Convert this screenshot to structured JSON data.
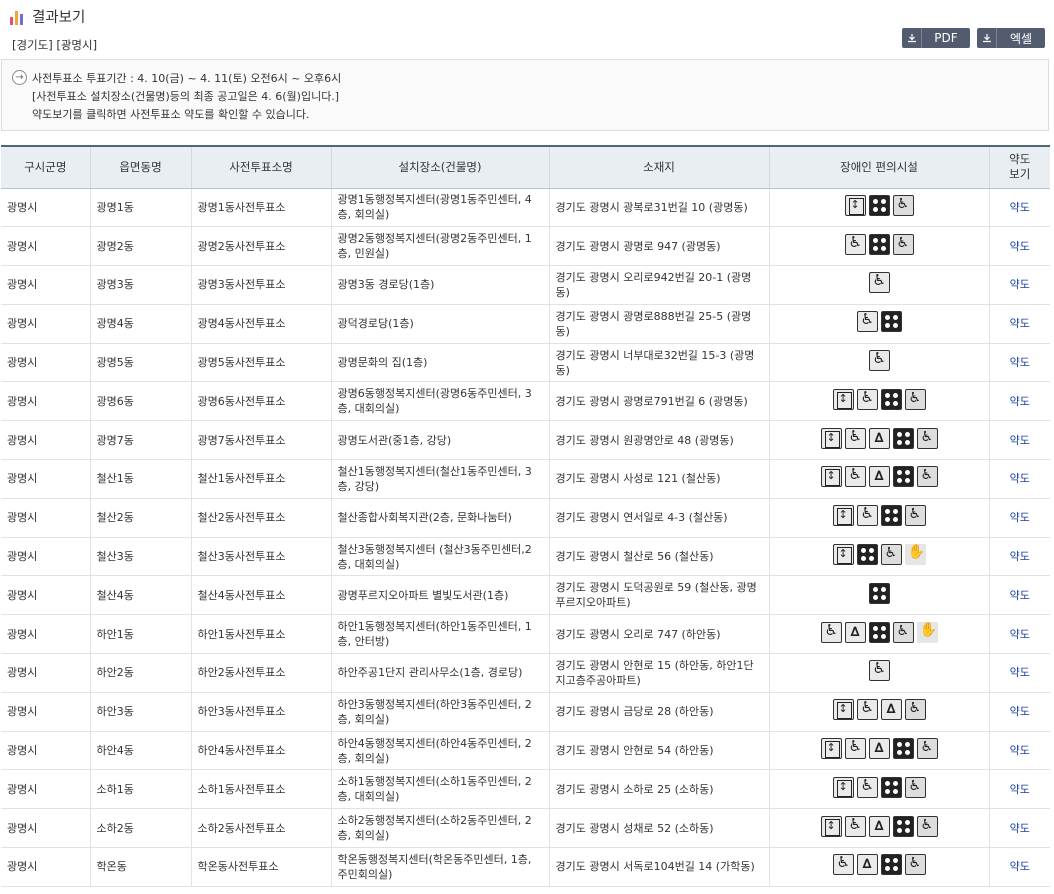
{
  "header": {
    "title": "결과보기",
    "region": "[경기도] [광명시]"
  },
  "export": {
    "pdf_label": "PDF",
    "excel_label": "엑셀"
  },
  "notice": [
    "사전투표소 투표기간 : 4. 10(금) ~ 4. 11(토) 오전6시 ~ 오후6시",
    "[사전투표소 설치장소(건물명)등의 최종 공고일은 4. 6(월)입니다.]",
    "약도보기를 클릭하면 사전투표소 약도를 확인할 수 있습니다."
  ],
  "table": {
    "headers": [
      "구시군명",
      "읍면동명",
      "사전투표소명",
      "설치장소(건물명)",
      "소재지",
      "장애인 편의시설",
      "약도\n보기"
    ],
    "map_label": "약도",
    "rows": [
      [
        "광명시",
        "광명1동",
        "광명1동사전투표소",
        "광명1동행정복지센터(광명1동주민센터, 4층, 회의실)",
        "경기도 광명시 광복로31번길 10 (광명동)"
      ],
      [
        "광명시",
        "광명2동",
        "광명2동사전투표소",
        "광명2동행정복지센터(광명2동주민센터, 1층, 민원실)",
        "경기도 광명시 광명로 947 (광명동)"
      ],
      [
        "광명시",
        "광명3동",
        "광명3동사전투표소",
        "광명3동 경로당(1층)",
        "경기도 광명시 오리로942번길 20-1 (광명동)"
      ],
      [
        "광명시",
        "광명4동",
        "광명4동사전투표소",
        "광덕경로당(1층)",
        "경기도 광명시 광명로888번길 25-5 (광명동)"
      ],
      [
        "광명시",
        "광명5동",
        "광명5동사전투표소",
        "광명문화의 집(1층)",
        "경기도 광명시 너부대로32번길 15-3 (광명동)"
      ],
      [
        "광명시",
        "광명6동",
        "광명6동사전투표소",
        "광명6동행정복지센터(광명6동주민센터, 3층, 대회의실)",
        "경기도 광명시 광명로791번길 6 (광명동)"
      ],
      [
        "광명시",
        "광명7동",
        "광명7동사전투표소",
        "광명도서관(중1층, 강당)",
        "경기도 광명시 원광명안로 48 (광명동)"
      ],
      [
        "광명시",
        "철산1동",
        "철산1동사전투표소",
        "철산1동행정복지센터(철산1동주민센터, 3층, 강당)",
        "경기도 광명시 사성로 121 (철산동)"
      ],
      [
        "광명시",
        "철산2동",
        "철산2동사전투표소",
        "철산종합사회복지관(2층, 문화나눔터)",
        "경기도 광명시 연서일로 4-3 (철산동)"
      ],
      [
        "광명시",
        "철산3동",
        "철산3동사전투표소",
        "철산3동행정복지센터 (철산3동주민센터,2층, 대회의실)",
        "경기도 광명시 철산로 56 (철산동)"
      ],
      [
        "광명시",
        "철산4동",
        "철산4동사전투표소",
        "광명푸르지오아파트 별빛도서관(1층)",
        "경기도 광명시 도덕공원로 59 (철산동, 광명푸르지오아파트)"
      ],
      [
        "광명시",
        "하안1동",
        "하안1동사전투표소",
        "하안1동행정복지센터(하안1동주민센터, 1층, 안터방)",
        "경기도 광명시 오리로 747 (하안동)"
      ],
      [
        "광명시",
        "하안2동",
        "하안2동사전투표소",
        "하안주공1단지 관리사무소(1층, 경로당)",
        "경기도 광명시 안현로 15 (하안동, 하안1단지고층주공아파트)"
      ],
      [
        "광명시",
        "하안3동",
        "하안3동사전투표소",
        "하안3동행정복지센터(하안3동주민센터, 2층, 회의실)",
        "경기도 광명시 금당로 28 (하안동)"
      ],
      [
        "광명시",
        "하안4동",
        "하안4동사전투표소",
        "하안4동행정복지센터(하안4동주민센터, 2층, 회의실)",
        "경기도 광명시 안현로 54 (하안동)"
      ],
      [
        "광명시",
        "소하1동",
        "소하1동사전투표소",
        "소하1동행정복지센터(소하1동주민센터, 2층, 대회의실)",
        "경기도 광명시 소하로 25 (소하동)"
      ],
      [
        "광명시",
        "소하2동",
        "소하2동사전투표소",
        "소하2동행정복지센터(소하2동주민센터, 2층, 회의실)",
        "경기도 광명시 성채로 52 (소하동)"
      ],
      [
        "광명시",
        "학온동",
        "학온동사전투표소",
        "학온동행정복지센터(학온동주민센터, 1층, 주민회의실)",
        "경기도 광명시 서독로104번길 14 (가학동)"
      ]
    ],
    "facilities": [
      [
        "elevator-icon",
        "parking-icon",
        "wheelchair-icon"
      ],
      [
        "ramp-icon",
        "parking-icon",
        "wheelchair-icon"
      ],
      [
        "ramp-icon"
      ],
      [
        "ramp-icon",
        "parking-icon"
      ],
      [
        "ramp-icon"
      ],
      [
        "elevator-icon",
        "ramp-icon",
        "parking-icon",
        "wheelchair-icon"
      ],
      [
        "elevator-icon",
        "ramp-icon",
        "toilet-icon",
        "parking-icon",
        "wheelchair-icon"
      ],
      [
        "elevator-icon",
        "ramp-icon",
        "toilet-icon",
        "parking-icon",
        "wheelchair-icon"
      ],
      [
        "elevator-icon",
        "ramp-icon",
        "parking-icon",
        "wheelchair-icon"
      ],
      [
        "elevator-icon",
        "parking-icon",
        "wheelchair-icon",
        "sign-language-icon"
      ],
      [
        "parking-icon"
      ],
      [
        "ramp-icon",
        "toilet-icon",
        "parking-icon",
        "wheelchair-icon",
        "sign-language-icon"
      ],
      [
        "ramp-icon"
      ],
      [
        "elevator-icon",
        "ramp-icon",
        "toilet-icon",
        "wheelchair-icon"
      ],
      [
        "elevator-icon",
        "ramp-icon",
        "toilet-icon",
        "parking-icon",
        "wheelchair-icon"
      ],
      [
        "elevator-icon",
        "ramp-icon",
        "parking-icon",
        "wheelchair-icon"
      ],
      [
        "elevator-icon",
        "ramp-icon",
        "toilet-icon",
        "parking-icon",
        "wheelchair-icon"
      ],
      [
        "ramp-icon",
        "toilet-icon",
        "parking-icon",
        "wheelchair-icon"
      ]
    ]
  },
  "colors": {
    "header_border": "#4d6673",
    "header_bg": "#e8eef1",
    "link": "#1a3fa3",
    "button_bg": "#535c6e"
  }
}
